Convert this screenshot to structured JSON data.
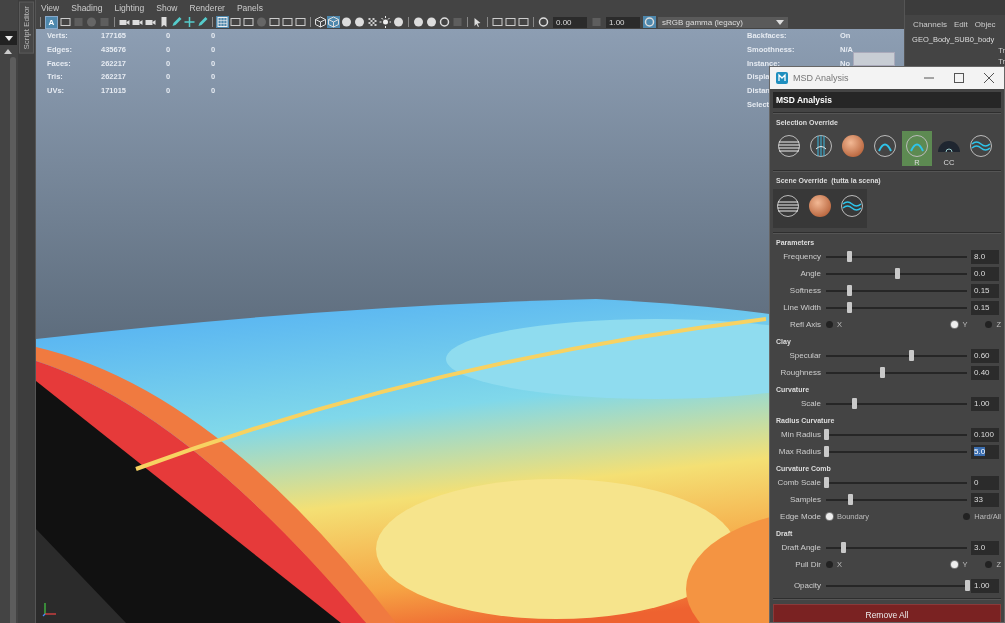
{
  "left_panel": {
    "tab": "Script Editor"
  },
  "menu": [
    "View",
    "Shading",
    "Lighting",
    "Show",
    "Renderer",
    "Panels"
  ],
  "toolbar": [
    {
      "kind": "sep"
    },
    {
      "kind": "letter",
      "text": "A",
      "on": true
    },
    {
      "kind": "frame",
      "on": false
    },
    {
      "kind": "square",
      "on": false
    },
    {
      "kind": "circle",
      "on": false
    },
    {
      "kind": "square",
      "on": false
    },
    {
      "kind": "sep"
    },
    {
      "kind": "camera",
      "on": false
    },
    {
      "kind": "camera",
      "on": false
    },
    {
      "kind": "camera",
      "on": false
    },
    {
      "kind": "flag",
      "on": false
    },
    {
      "kind": "pen",
      "on": false
    },
    {
      "kind": "move",
      "on": false
    },
    {
      "kind": "pen",
      "on": false
    },
    {
      "kind": "sep"
    },
    {
      "kind": "grid",
      "on": true
    },
    {
      "kind": "frame",
      "on": false
    },
    {
      "kind": "frame",
      "on": false
    },
    {
      "kind": "circle",
      "on": false
    },
    {
      "kind": "frame",
      "on": false
    },
    {
      "kind": "frame",
      "on": false
    },
    {
      "kind": "frame",
      "on": false
    },
    {
      "kind": "sep"
    },
    {
      "kind": "cube",
      "on": false
    },
    {
      "kind": "cube",
      "on": true
    },
    {
      "kind": "sphere",
      "on": false
    },
    {
      "kind": "sphere",
      "on": false
    },
    {
      "kind": "checker",
      "on": false
    },
    {
      "kind": "light",
      "on": false
    },
    {
      "kind": "sphere",
      "on": false
    },
    {
      "kind": "sep"
    },
    {
      "kind": "sphere",
      "on": false
    },
    {
      "kind": "sphere",
      "on": false
    },
    {
      "kind": "ring",
      "on": false
    },
    {
      "kind": "square",
      "on": false
    },
    {
      "kind": "sep"
    },
    {
      "kind": "cursor",
      "on": false
    },
    {
      "kind": "sep"
    },
    {
      "kind": "frame",
      "on": false
    },
    {
      "kind": "frame",
      "on": false
    },
    {
      "kind": "frame",
      "on": false
    },
    {
      "kind": "sep"
    },
    {
      "kind": "ring",
      "on": false
    },
    {
      "kind": "field",
      "value": "0.00"
    },
    {
      "kind": "square",
      "on": false
    },
    {
      "kind": "field",
      "value": "1.00"
    },
    {
      "kind": "ring",
      "on": true
    },
    {
      "kind": "dropdown",
      "value": "sRGB gamma (legacy)"
    }
  ],
  "hud_stats": [
    {
      "label": "Verts:",
      "values": [
        "177165",
        "0",
        "0"
      ]
    },
    {
      "label": "Edges:",
      "values": [
        "435676",
        "0",
        "0"
      ]
    },
    {
      "label": "Faces:",
      "values": [
        "262217",
        "0",
        "0"
      ]
    },
    {
      "label": "Tris:",
      "values": [
        "262217",
        "0",
        "0"
      ]
    },
    {
      "label": "UVs:",
      "values": [
        "171015",
        "0",
        "0"
      ]
    }
  ],
  "hud_info": [
    {
      "label": "Backfaces:",
      "value": "On"
    },
    {
      "label": "Smoothness:",
      "value": "N/A"
    },
    {
      "label": "Instance:",
      "value": "No"
    },
    {
      "label": "Displa"
    },
    {
      "label": "Distan"
    },
    {
      "label": "Select"
    }
  ],
  "channel_box": {
    "menu": [
      "Channels",
      "Edit",
      "Objec"
    ],
    "object": "GEO_Body_SUB0_body",
    "attributes": [
      "Tr",
      "Tr"
    ]
  },
  "dialog": {
    "title": "MSD Analysis",
    "header": "MSD Analysis",
    "selection_override": {
      "title": "Selection Override",
      "buttons": [
        {
          "kind": "stripes",
          "selected": false
        },
        {
          "kind": "lines",
          "selected": false
        },
        {
          "kind": "clay",
          "selected": false
        },
        {
          "kind": "arch",
          "selected": false
        },
        {
          "kind": "arch",
          "label": "R",
          "selected": true
        },
        {
          "kind": "dome",
          "label": "CC",
          "selected": false
        },
        {
          "kind": "wave",
          "selected": false
        }
      ]
    },
    "scene_override": {
      "title": "Scene Override  (tutta la scena)",
      "buttons": [
        {
          "kind": "stripes",
          "selected": false
        },
        {
          "kind": "clay",
          "selected": false
        },
        {
          "kind": "wave",
          "selected": false
        }
      ]
    },
    "sections": [
      {
        "title": "Parameters",
        "rows": [
          {
            "kind": "slider",
            "label": "Frequency",
            "level": 0.16,
            "value": "8.0",
            "highlighted": false
          },
          {
            "kind": "slider",
            "label": "Angle",
            "level": 0.5,
            "value": "0.0",
            "highlighted": false
          },
          {
            "kind": "slider",
            "label": "Softness",
            "level": 0.16,
            "value": "0.15",
            "highlighted": false
          },
          {
            "kind": "slider",
            "label": "Line Width",
            "level": 0.16,
            "value": "0.15",
            "highlighted": false
          },
          {
            "kind": "radio",
            "label": "Refl Axis",
            "options": [
              {
                "label": "X",
                "selected": false
              },
              {
                "label": "Y",
                "selected": true
              },
              {
                "label": "Z",
                "selected": false
              }
            ]
          }
        ]
      },
      {
        "title": "Clay",
        "rows": [
          {
            "kind": "slider",
            "label": "Specular",
            "level": 0.6,
            "value": "0.60",
            "highlighted": false
          },
          {
            "kind": "slider",
            "label": "Roughness",
            "level": 0.4,
            "value": "0.40",
            "highlighted": false
          }
        ]
      },
      {
        "title": "Curvature",
        "rows": [
          {
            "kind": "slider",
            "label": "Scale",
            "level": 0.2,
            "value": "1.00",
            "highlighted": false
          }
        ]
      },
      {
        "title": "Radius Curvature",
        "rows": [
          {
            "kind": "slider",
            "label": "Min Radius",
            "level": 0.0,
            "value": "0.100",
            "highlighted": false
          },
          {
            "kind": "slider",
            "label": "Max Radius",
            "level": 0.0,
            "value": "5.0",
            "highlighted": true
          }
        ]
      },
      {
        "title": "Curvature Comb",
        "rows": [
          {
            "kind": "slider",
            "label": "Comb Scale",
            "level": 0.0,
            "value": "0",
            "highlighted": false
          },
          {
            "kind": "slider",
            "label": "Samples",
            "level": 0.17,
            "value": "33",
            "highlighted": false
          },
          {
            "kind": "radio",
            "label": "Edge Mode",
            "options": [
              {
                "label": "Boundary",
                "selected": true
              },
              {
                "label": "Hard/All",
                "selected": false
              }
            ]
          }
        ]
      },
      {
        "title": "Draft",
        "rows": [
          {
            "kind": "slider",
            "label": "Draft Angle",
            "level": 0.12,
            "value": "3.0",
            "highlighted": false
          },
          {
            "kind": "radio",
            "label": "Pull Dir",
            "options": [
              {
                "label": "X",
                "selected": false
              },
              {
                "label": "Y",
                "selected": true
              },
              {
                "label": "Z",
                "selected": false
              }
            ]
          }
        ]
      },
      {
        "rows": [
          {
            "kind": "slider",
            "label": "Opacity",
            "level": 1.0,
            "value": "1.00",
            "highlighted": false
          }
        ]
      }
    ],
    "button": "Remove All"
  }
}
